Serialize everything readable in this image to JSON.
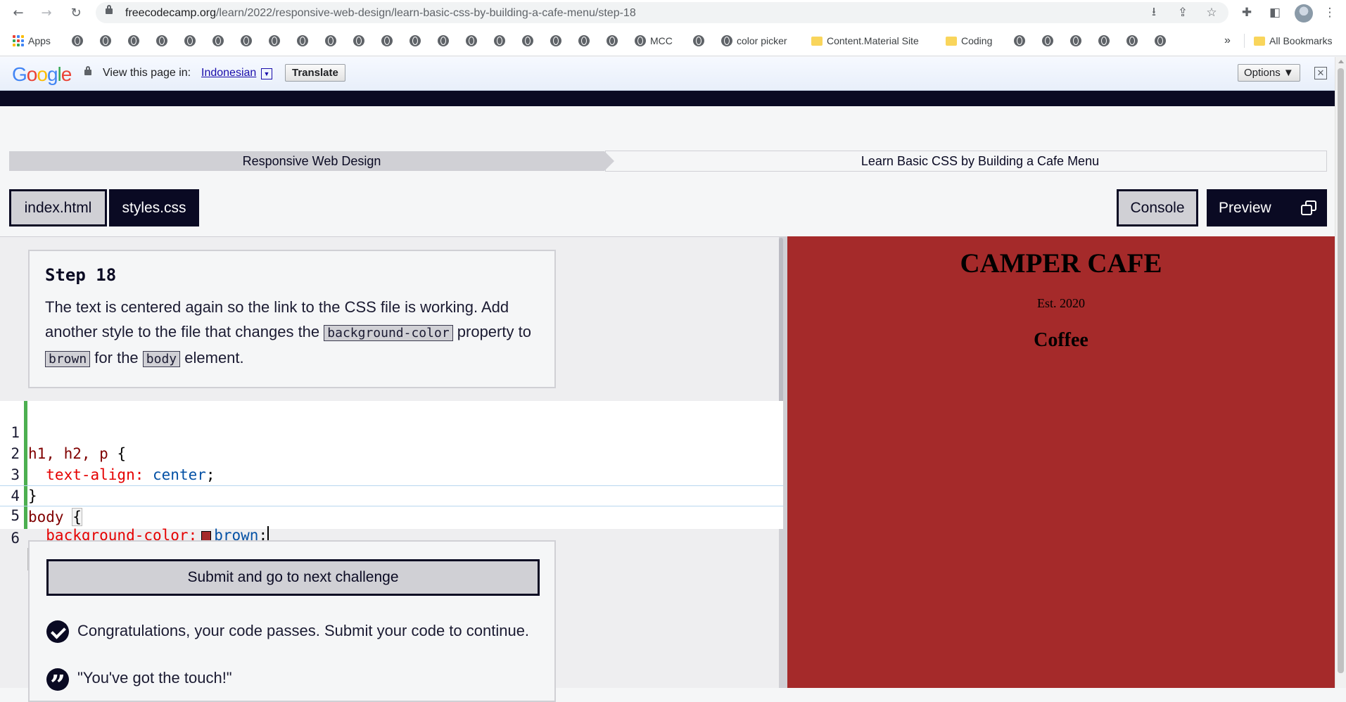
{
  "browser": {
    "url_host": "freecodecamp.org",
    "url_path": "/learn/2022/responsive-web-design/learn-basic-css-by-building-a-cafe-menu/step-18",
    "back_icon": "←",
    "forward_icon": "→",
    "reload_icon": "↻",
    "download_icon": "⭳",
    "share_icon": "⇪",
    "star_icon": "☆",
    "extensions_icon": "✚",
    "sidepanel_icon": "◧",
    "menu_icon": "⋮"
  },
  "bookmarks": {
    "apps_label": "Apps",
    "mcc_label": "MCC",
    "color_picker_label": "color picker",
    "content_material_label": "Content.Material Site",
    "coding_label": "Coding",
    "overflow_label": "»",
    "all_bookmarks_label": "All Bookmarks"
  },
  "translate_bar": {
    "logo": "Google",
    "prompt": "View this page in:",
    "language": "Indonesian",
    "dropdown_glyph": "▼",
    "translate_button": "Translate",
    "options_button": "Options ▼",
    "close_glyph": "✕"
  },
  "breadcrumb": {
    "superblock": "Responsive Web Design",
    "block": "Learn Basic CSS by Building a Cafe Menu"
  },
  "tabs": {
    "index": "index.html",
    "styles": "styles.css",
    "console": "Console",
    "preview": "Preview"
  },
  "step": {
    "title": "Step 18",
    "text_1": "The text is centered again so the link to the CSS file is working. Add another style to the file that changes the ",
    "code_1": "background-color",
    "text_2": " property to ",
    "code_2": "brown",
    "text_3": " for the ",
    "code_3": "body",
    "text_4": " element."
  },
  "editor": {
    "line_numbers": [
      "1",
      "2",
      "3",
      "4",
      "5",
      "6"
    ],
    "l1_sel": "h1, h2, p ",
    "l1_brace": "{",
    "l2_prop": "  text-align:",
    "l2_val": " center",
    "l2_end": ";",
    "l3": "}",
    "l4_sel": "body ",
    "l4_brace": "{",
    "l5_prop": "  background-color:",
    "l5_val": "brown",
    "l5_end": ";",
    "l6": "}",
    "swatch_color": "#a52a2a"
  },
  "result": {
    "submit_button": "Submit and go to next challenge",
    "pass_message": "Congratulations, your code passes. Submit your code to continue.",
    "quote": "\"You've got the touch!\""
  },
  "preview": {
    "background": "#a52a2a",
    "title": "CAMPER CAFE",
    "established": "Est. 2020",
    "section": "Coffee"
  }
}
